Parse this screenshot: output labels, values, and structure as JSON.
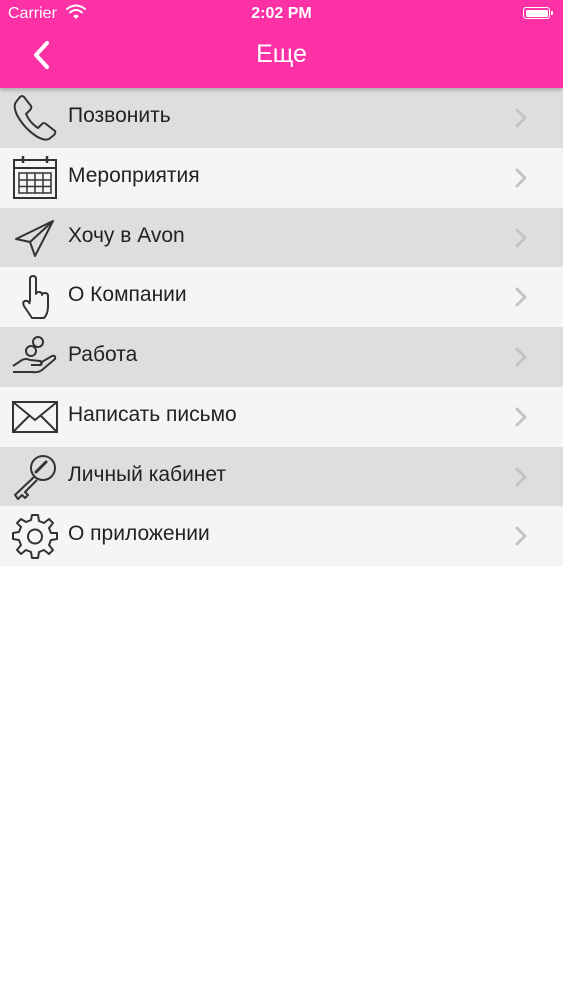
{
  "status_bar": {
    "carrier": "Carrier",
    "time": "2:02 PM"
  },
  "nav": {
    "title": "Еще",
    "back_icon": "chevron-left-icon"
  },
  "colors": {
    "header": "#fc31a6",
    "row_odd": "#dedede",
    "row_even": "#f5f5f5"
  },
  "menu": {
    "items": [
      {
        "label": "Позвонить",
        "icon": "phone-icon"
      },
      {
        "label": "Мероприятия",
        "icon": "calendar-icon"
      },
      {
        "label": "Хочу в Avon",
        "icon": "paper-plane-icon"
      },
      {
        "label": "О Компании",
        "icon": "hand-pointer-icon"
      },
      {
        "label": "Работа",
        "icon": "hand-coins-icon"
      },
      {
        "label": "Написать письмо",
        "icon": "envelope-icon"
      },
      {
        "label": "Личный кабинет",
        "icon": "key-icon"
      },
      {
        "label": "О приложении",
        "icon": "gear-icon"
      }
    ]
  }
}
